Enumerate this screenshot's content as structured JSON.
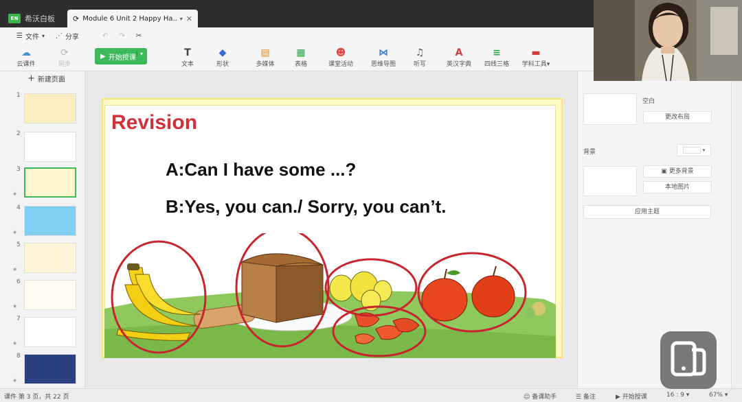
{
  "titlebar": {
    "app_logo": "EN",
    "app_tab_label": "希沃白板",
    "doc_tab_label": "Module 6 Unit 2 Happy Ha...",
    "tab_dropdown": "▾",
    "close_symbol": "✕"
  },
  "menu": {
    "file_label": "文件",
    "file_dropdown": "▾",
    "share_label": "分享"
  },
  "toolbar": {
    "cloud_label": "云课件",
    "sync_label": "同步",
    "start_label": "开始授课",
    "items": [
      {
        "label": "文本",
        "icon": "text-icon"
      },
      {
        "label": "形状",
        "icon": "shape-icon"
      },
      {
        "label": "多媒体",
        "icon": "media-icon"
      },
      {
        "label": "表格",
        "icon": "table-icon"
      },
      {
        "label": "课堂活动",
        "icon": "activity-icon"
      },
      {
        "label": "思维导图",
        "icon": "mindmap-icon"
      },
      {
        "label": "听写",
        "icon": "dictation-icon"
      },
      {
        "label": "英汉字典",
        "icon": "dictionary-icon"
      },
      {
        "label": "四线三格",
        "icon": "four-line-icon"
      },
      {
        "label": "学科工具▾",
        "icon": "subject-tools-icon"
      }
    ]
  },
  "left_panel": {
    "new_page_label": "新建页面",
    "pages": [
      "1",
      "2",
      "3",
      "4",
      "5",
      "6",
      "7",
      "8"
    ],
    "selected_page": 3
  },
  "slide": {
    "title": "Revision",
    "line_a": "A:Can I have some ...?",
    "line_b": "B:Yes, you can./ Sorry, you can’t."
  },
  "right_panel": {
    "blank_label": "空白",
    "change_layout_label": "更改布局",
    "background_label": "背景",
    "more_backgrounds_label": "更多背景",
    "local_image_label": "本地图片",
    "apply_theme_label": "应用主题"
  },
  "status": {
    "page_info": "课件 第 3 页，共 22 页",
    "assistant_label": "备课助手",
    "notes_label": "备注",
    "start_label": "开始授课",
    "ratio_label": "16 : 9 ▾",
    "zoom_label": "67% ▾"
  },
  "colors": {
    "accent_green": "#3cb95a",
    "revision_red": "#d3313a",
    "circle_red": "#c8242b"
  }
}
